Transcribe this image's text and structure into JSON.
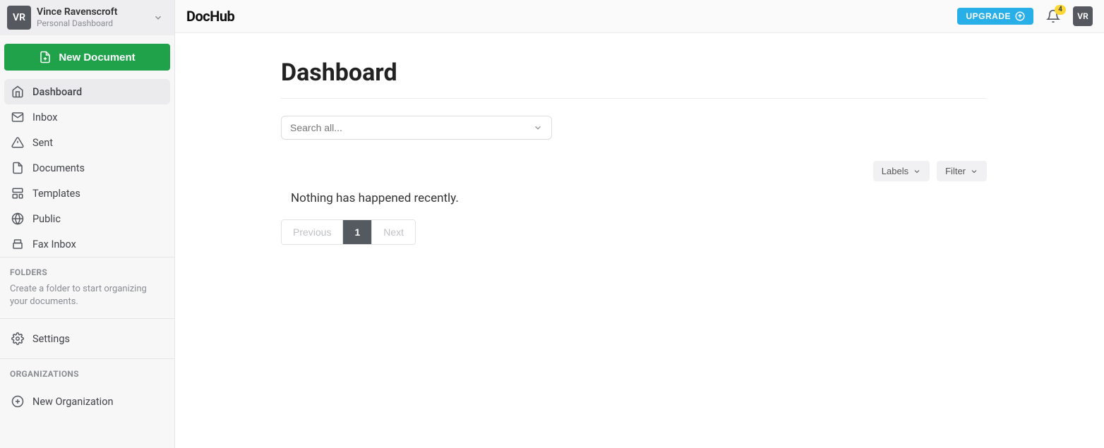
{
  "profile": {
    "initials": "VR",
    "name": "Vince Ravenscroft",
    "subtitle": "Personal Dashboard"
  },
  "sidebar": {
    "new_doc_label": "New Document",
    "items": [
      {
        "label": "Dashboard"
      },
      {
        "label": "Inbox"
      },
      {
        "label": "Sent"
      },
      {
        "label": "Documents"
      },
      {
        "label": "Templates"
      },
      {
        "label": "Public"
      },
      {
        "label": "Fax Inbox"
      }
    ],
    "folders": {
      "title": "FOLDERS",
      "help": "Create a folder to start organizing your documents."
    },
    "settings_label": "Settings",
    "organizations": {
      "title": "ORGANIZATIONS",
      "new_label": "New Organization"
    }
  },
  "topbar": {
    "logo": "DocHub",
    "upgrade_label": "UPGRADE",
    "notification_count": "4",
    "avatar_initials": "VR"
  },
  "main": {
    "title": "Dashboard",
    "search_placeholder": "Search all...",
    "labels_btn": "Labels",
    "filter_btn": "Filter",
    "empty_text": "Nothing has happened recently.",
    "pager": {
      "prev": "Previous",
      "page": "1",
      "next": "Next"
    }
  }
}
